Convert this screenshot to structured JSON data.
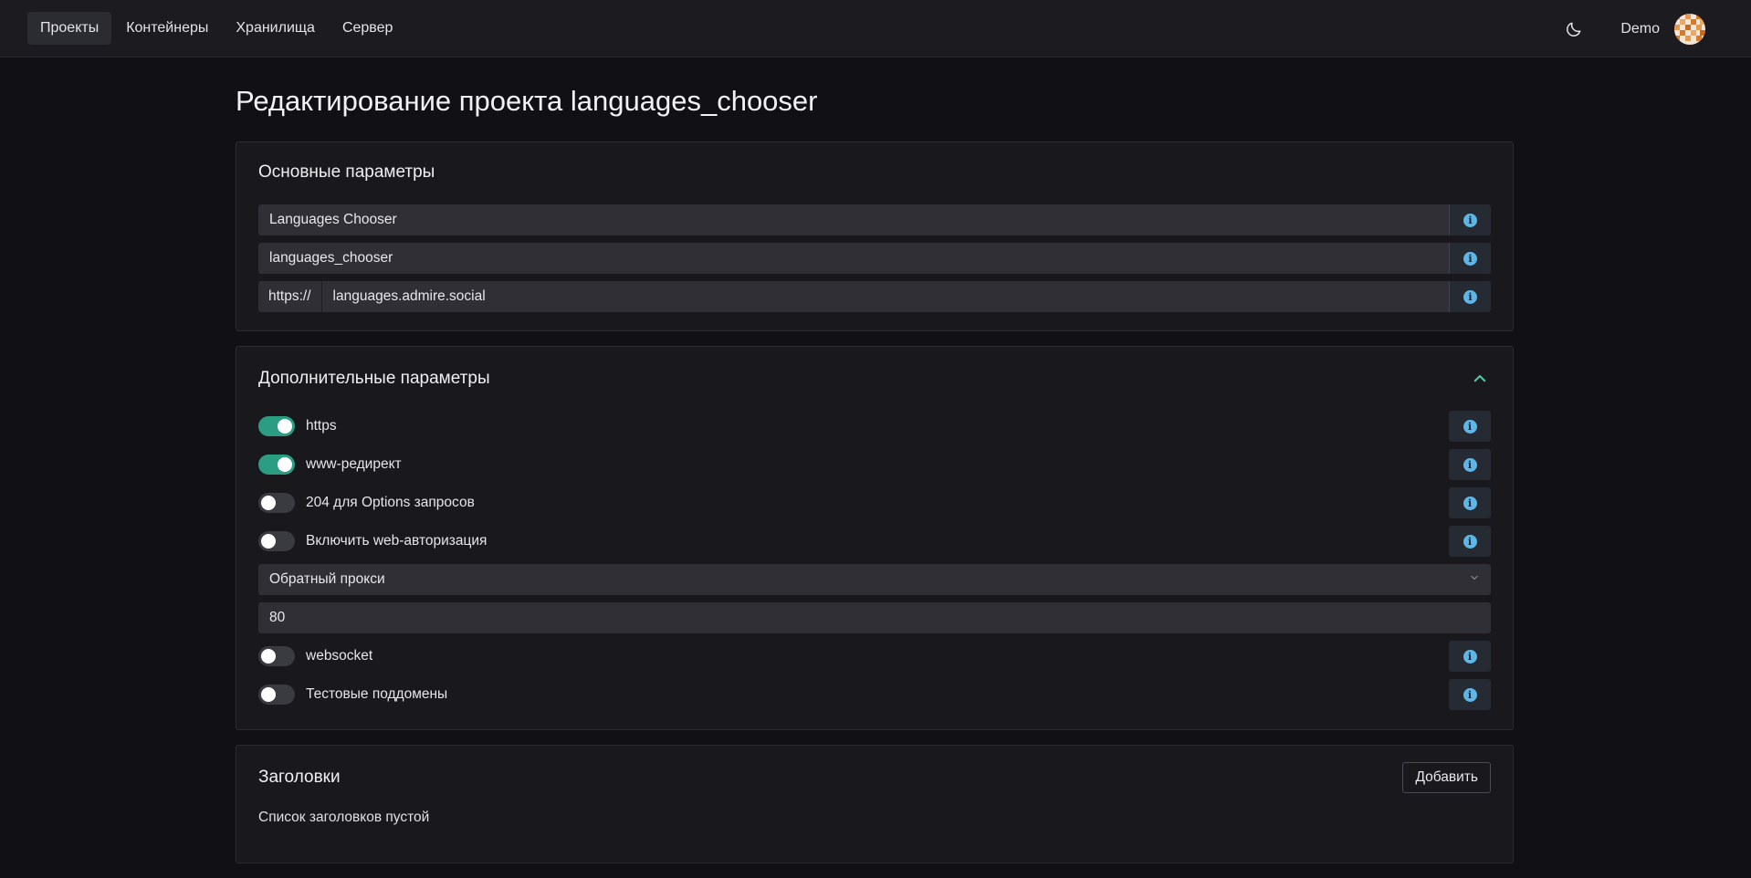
{
  "nav": {
    "items": [
      {
        "label": "Проекты",
        "active": true
      },
      {
        "label": "Контейнеры",
        "active": false
      },
      {
        "label": "Хранилища",
        "active": false
      },
      {
        "label": "Сервер",
        "active": false
      }
    ]
  },
  "user": {
    "name": "Demo",
    "theme_icon": "moon-icon"
  },
  "page": {
    "title": "Редактирование проекта languages_chooser"
  },
  "basic": {
    "title": "Основные параметры",
    "name_value": "Languages Chooser",
    "slug_value": "languages_chooser",
    "domain_prefix": "https://",
    "domain_value": "languages.admire.social"
  },
  "advanced": {
    "title": "Дополнительные параметры",
    "toggles": [
      {
        "label": "https",
        "on": true
      },
      {
        "label": "www-редирект",
        "on": true
      },
      {
        "label": "204 для Options запросов",
        "on": false
      },
      {
        "label": "Включить web-авторизация",
        "on": false
      }
    ],
    "proxy_select": "Обратный прокси",
    "port_value": "80",
    "toggles2": [
      {
        "label": "websocket",
        "on": false
      },
      {
        "label": "Тестовые поддомены",
        "on": false
      }
    ]
  },
  "headers": {
    "title": "Заголовки",
    "add_label": "Добавить",
    "empty_text": "Список заголовков пустой"
  },
  "colors": {
    "accent": "#2a9d82",
    "info": "#5cb6e8",
    "bg": "#111115"
  }
}
